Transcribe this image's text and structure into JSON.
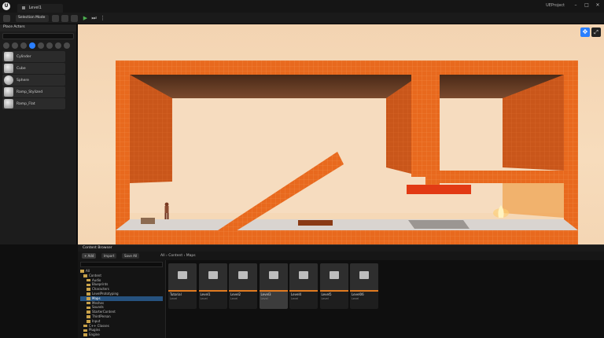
{
  "titlebar": {
    "logo": "U",
    "level_tab": "Level1",
    "project_name": "UEProject",
    "win_min": "–",
    "win_max": "□",
    "win_close": "✕"
  },
  "toolbar": {
    "mode": "Selection Mode",
    "play_icon": "▶",
    "next_icon": "⏭",
    "more_icon": "⋮"
  },
  "place_panel": {
    "title": "Place Actors",
    "items": [
      {
        "label": "Cylinder"
      },
      {
        "label": "Cube"
      },
      {
        "label": "Sphere"
      },
      {
        "label": "Ramp_Stylized"
      },
      {
        "label": "Ramp_Flat"
      }
    ]
  },
  "viewport": {
    "move_icon": "✥",
    "fullscreen_icon": "⤢"
  },
  "content_browser": {
    "tab": "Content Browser",
    "add_label": "+ Add",
    "import_label": "Import",
    "save_all_label": "Save All",
    "breadcrumb": "All  ›  Content  ›  Maps",
    "tree": [
      {
        "label": "All",
        "indent": 0
      },
      {
        "label": "Content",
        "indent": 1
      },
      {
        "label": "Audio",
        "indent": 2
      },
      {
        "label": "Blueprints",
        "indent": 2
      },
      {
        "label": "Characters",
        "indent": 2
      },
      {
        "label": "LevelPrototyping",
        "indent": 2
      },
      {
        "label": "Maps",
        "indent": 2,
        "selected": true
      },
      {
        "label": "Meshes",
        "indent": 2
      },
      {
        "label": "Sounds",
        "indent": 2
      },
      {
        "label": "StarterContent",
        "indent": 2
      },
      {
        "label": "ThirdPerson",
        "indent": 2
      },
      {
        "label": "Input",
        "indent": 2
      },
      {
        "label": "C++ Classes",
        "indent": 1
      },
      {
        "label": "Plugins",
        "indent": 1
      },
      {
        "label": "Engine",
        "indent": 1
      }
    ],
    "assets": [
      {
        "name": "Tutorial",
        "type": "Level"
      },
      {
        "name": "Level1",
        "type": "Level"
      },
      {
        "name": "Level2",
        "type": "Level"
      },
      {
        "name": "Level3",
        "type": "Level",
        "selected": true
      },
      {
        "name": "Level4",
        "type": "Level"
      },
      {
        "name": "Level5",
        "type": "Level"
      },
      {
        "name": "Level06",
        "type": "Level"
      }
    ]
  }
}
